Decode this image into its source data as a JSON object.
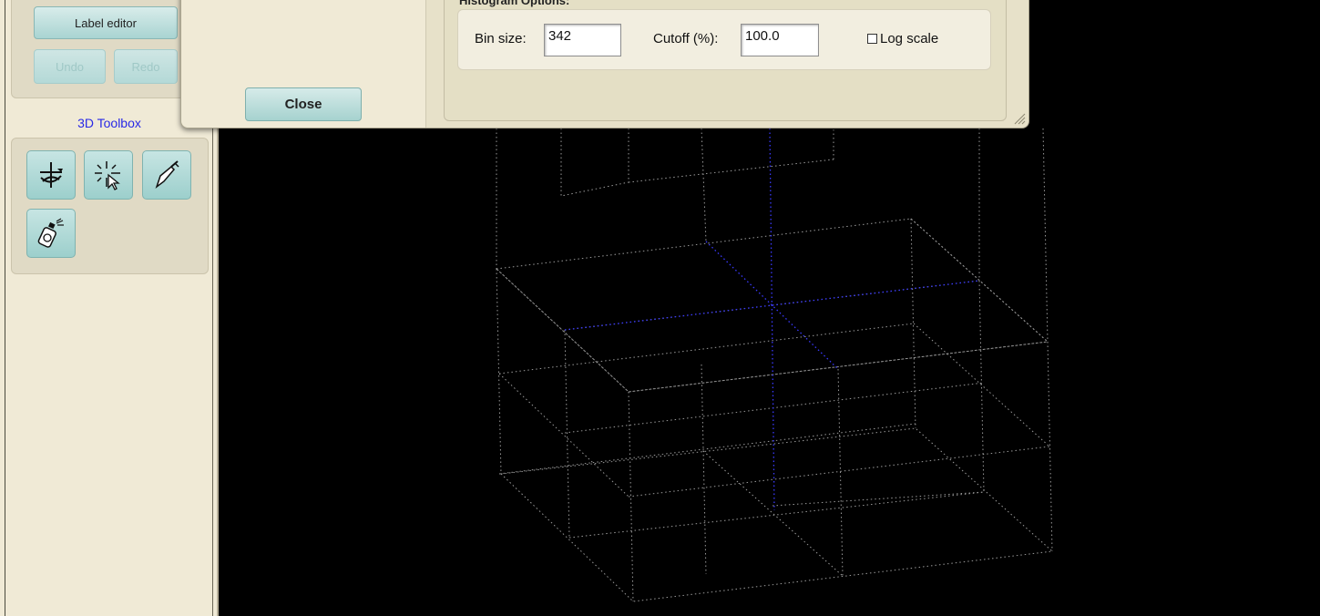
{
  "left_panel": {
    "label_editor_button": "Label editor",
    "undo_button": "Undo",
    "redo_button": "Redo",
    "toolbox_title": "3D Toolbox",
    "tools": [
      {
        "icon": "rotate-tool-icon"
      },
      {
        "icon": "select-cursor-icon"
      },
      {
        "icon": "scalpel-icon"
      },
      {
        "icon": "spray-can-icon"
      }
    ]
  },
  "dialog": {
    "close_button": "Close",
    "histogram": {
      "title": "Histogram Options:",
      "bin_size_label": "Bin size:",
      "bin_size_value": "342",
      "cutoff_label": "Cutoff (%):",
      "cutoff_value": "100.0",
      "log_scale_label": "Log scale",
      "log_scale_checked": false
    }
  },
  "viewport": {
    "background": "#000000",
    "grid_color": "#9a9a9a",
    "axis_color": "#3a3aff"
  }
}
